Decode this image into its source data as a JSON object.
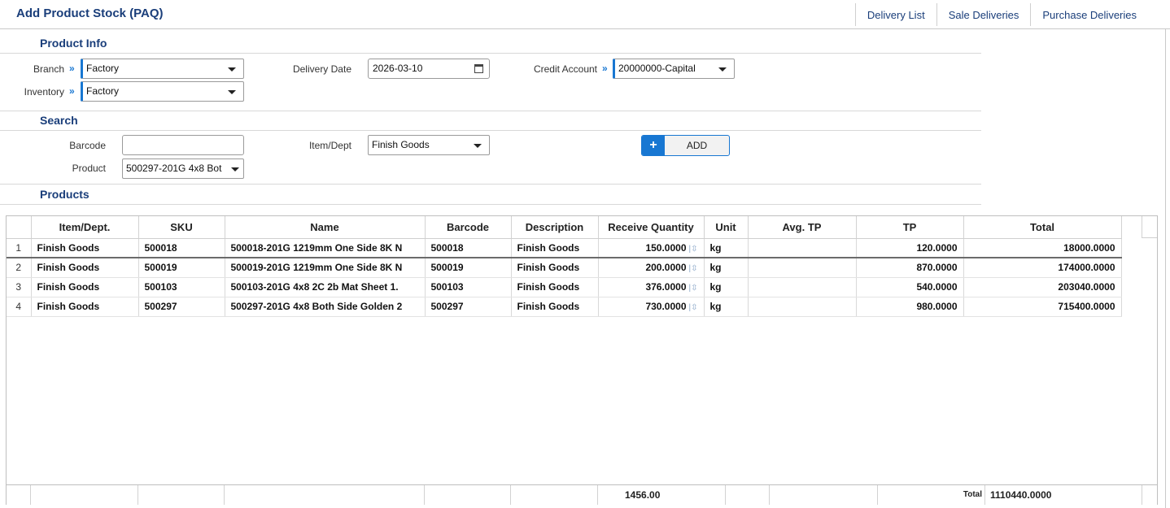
{
  "header": {
    "title": "Add Product Stock (PAQ)",
    "links": [
      "Delivery List",
      "Sale Deliveries",
      "Purchase Deliveries"
    ]
  },
  "product_info": {
    "section_title": "Product Info",
    "branch_label": "Branch",
    "branch_value": "Factory",
    "inventory_label": "Inventory",
    "inventory_value": "Factory",
    "delivery_date_label": "Delivery Date",
    "delivery_date_value": "2026-03-10",
    "credit_account_label": "Credit Account",
    "credit_account_value": "20000000-Capital"
  },
  "search": {
    "section_title": "Search",
    "barcode_label": "Barcode",
    "barcode_value": "",
    "product_label": "Product",
    "product_value": "500297-201G 4x8 Bot",
    "item_dept_label": "Item/Dept",
    "item_dept_value": "Finish Goods",
    "add_label": "ADD"
  },
  "products": {
    "section_title": "Products",
    "columns": [
      "Item/Dept.",
      "SKU",
      "Name",
      "Barcode",
      "Description",
      "Receive Quantity",
      "Unit",
      "Avg. TP",
      "TP",
      "Total"
    ],
    "rows": [
      {
        "n": "1",
        "item": "Finish Goods",
        "sku": "500018",
        "name": "500018-201G 1219mm One Side 8K N",
        "barcode": "500018",
        "desc": "Finish Goods",
        "qty": "150.0000",
        "unit": "kg",
        "avg": "",
        "tp": "120.0000",
        "total": "18000.0000"
      },
      {
        "n": "2",
        "item": "Finish Goods",
        "sku": "500019",
        "name": "500019-201G 1219mm One Side 8K N",
        "barcode": "500019",
        "desc": "Finish Goods",
        "qty": "200.0000",
        "unit": "kg",
        "avg": "",
        "tp": "870.0000",
        "total": "174000.0000"
      },
      {
        "n": "3",
        "item": "Finish Goods",
        "sku": "500103",
        "name": "500103-201G 4x8 2C 2b Mat Sheet 1.",
        "barcode": "500103",
        "desc": "Finish Goods",
        "qty": "376.0000",
        "unit": "kg",
        "avg": "",
        "tp": "540.0000",
        "total": "203040.0000"
      },
      {
        "n": "4",
        "item": "Finish Goods",
        "sku": "500297",
        "name": "500297-201G 4x8 Both Side Golden 2",
        "barcode": "500297",
        "desc": "Finish Goods",
        "qty": "730.0000",
        "unit": "kg",
        "avg": "",
        "tp": "980.0000",
        "total": "715400.0000"
      }
    ],
    "footer": {
      "qty_sum": "1456.00",
      "total_label": "Total",
      "total_value": "1110440.0000"
    }
  }
}
